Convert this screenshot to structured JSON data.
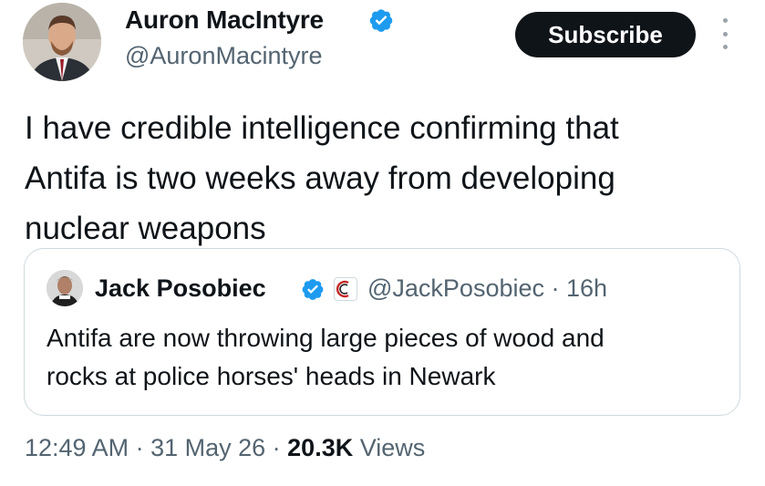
{
  "post": {
    "author": {
      "name": "Auron MacIntyre",
      "handle": "@AuronMacintyre",
      "verified": true
    },
    "subscribe_label": "Subscribe",
    "text": "I have credible intelligence confirming that\nAntifa is two weeks away from developing\nnuclear weapons",
    "quoted": {
      "author_name": "Jack Posobiec",
      "handle_time": "@JackPosobiec · 16h",
      "verified": true,
      "text": "Antifa are now throwing large pieces of wood and\nrocks at police horses' heads in Newark"
    },
    "meta": {
      "time": "12:49 AM",
      "sep1": " · ",
      "date": "31 May 26",
      "sep2": " · ",
      "views_count": "20.3K",
      "views_label": " Views"
    }
  },
  "colors": {
    "verified_blue": "#1d9bf0",
    "text_primary": "#0f1419",
    "text_secondary": "#536471",
    "border": "#cfd9de",
    "button_bg": "#0f1419"
  },
  "icons": {
    "verified": "verified-badge-icon",
    "more": "more-vertical-icon",
    "affiliate": "affiliate-badge-icon"
  }
}
